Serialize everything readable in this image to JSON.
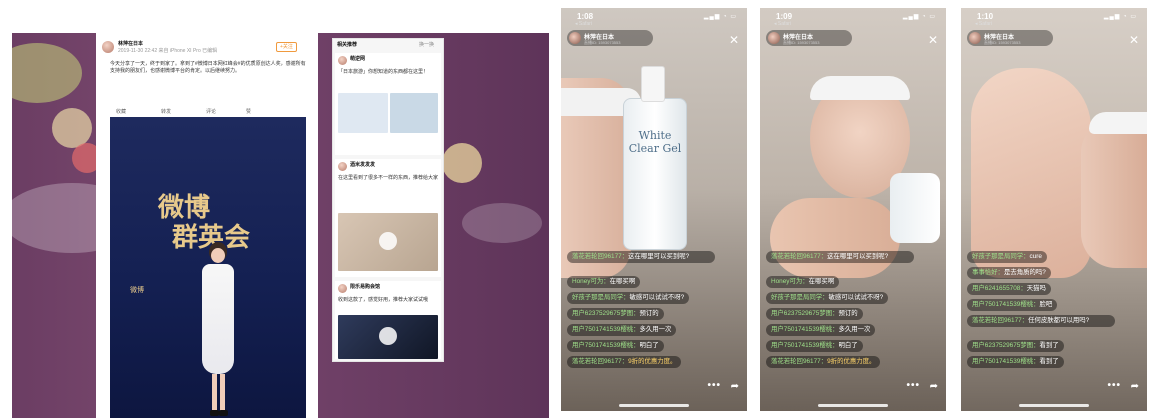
{
  "weibo_post": {
    "username": "林萍在日本",
    "meta": "2019-11-30 22:42 来自 iPhone XI Pro 已编辑",
    "follow_label": "+关注",
    "body_text": "今天分享了一天，终于到家了。拿到了#微博日本网红峰会#的优质原创达人奖，感谢所有支持我的朋友们，也感谢微博平台的肯定。以后继续努力。",
    "actions": [
      "收藏",
      "转发",
      "评论",
      "赞"
    ],
    "photo_title": "微博",
    "photo_subtitle": "群英会",
    "photo_brand": "微博"
  },
  "feed": {
    "header": "相关推荐",
    "refresh_label": "换一换",
    "items": [
      {
        "name": "萌逆网",
        "text": "「日本旅游」你想知道的东西都在这里！"
      },
      {
        "name": "酒米发发发",
        "text": "在这里看到了很多不一样的东西，推荐给大家"
      },
      {
        "name": "限乐易购会馆",
        "text": "收到这款了，感觉好用，推荐大家试试哦"
      }
    ]
  },
  "phones": [
    {
      "time": "1:08",
      "back_app": "◂ Safari",
      "host_name": "林萍在日本",
      "host_id": "直播ID: 1593073553",
      "close_icon": "✕",
      "more_icon": "•••",
      "share_icon": "➦",
      "product_text": "White\nClear Gel",
      "comments": [
        {
          "user": "落花若轮回96177：",
          "text": "这在哪里可以买到呢?",
          "wrap": true
        },
        {
          "user": "Honey可为：",
          "text": "在哪买啊"
        },
        {
          "user": "好孩子那是局同学：",
          "text": "敏感可以试试不呀?"
        },
        {
          "user": "用户6237529675梦图：",
          "text": "预订的"
        },
        {
          "user": "用户7501741539樱桃：",
          "text": "多久用一次"
        },
        {
          "user": "用户7501741539樱桃：",
          "text": "明白了"
        },
        {
          "user": "落花若轮回96177：",
          "text": "9折的优惠力度。",
          "gold": true
        }
      ]
    },
    {
      "time": "1:09",
      "back_app": "◂ Safari",
      "host_name": "林萍在日本",
      "host_id": "直播ID: 1593073553",
      "close_icon": "✕",
      "more_icon": "•••",
      "share_icon": "➦",
      "comments": [
        {
          "user": "落花若轮回96177：",
          "text": "这在哪里可以买到呢?",
          "wrap": true
        },
        {
          "user": "Honey可为：",
          "text": "在哪买啊"
        },
        {
          "user": "好孩子那是局同学：",
          "text": "敏感可以试试不呀?"
        },
        {
          "user": "用户6237529675梦图：",
          "text": "预订的"
        },
        {
          "user": "用户7501741539樱桃：",
          "text": "多久用一次"
        },
        {
          "user": "用户7501741539樱桃：",
          "text": "明白了"
        },
        {
          "user": "落花若轮回96177：",
          "text": "9折的优惠力度。",
          "gold": true
        }
      ]
    },
    {
      "time": "1:10",
      "back_app": "◂ Safari",
      "host_name": "林萍在日本",
      "host_id": "直播ID: 1593073553",
      "close_icon": "✕",
      "more_icon": "•••",
      "share_icon": "➦",
      "comments": [
        {
          "user": "好孩子那是局同学：",
          "text": "cure"
        },
        {
          "user": "事事恰好：",
          "text": "是去角质的吗?"
        },
        {
          "user": "用户6241655708：",
          "text": "天猫吗"
        },
        {
          "user": "用户7501741539樱桃：",
          "text": "脸吧"
        },
        {
          "user": "落花若轮回96177：",
          "text": "任何皮肤都可以用吗?",
          "wrap": true
        },
        {
          "user": "用户6237529675梦图：",
          "text": "看到了"
        },
        {
          "user": "用户7501741539樱桃：",
          "text": "看到了"
        }
      ]
    }
  ]
}
